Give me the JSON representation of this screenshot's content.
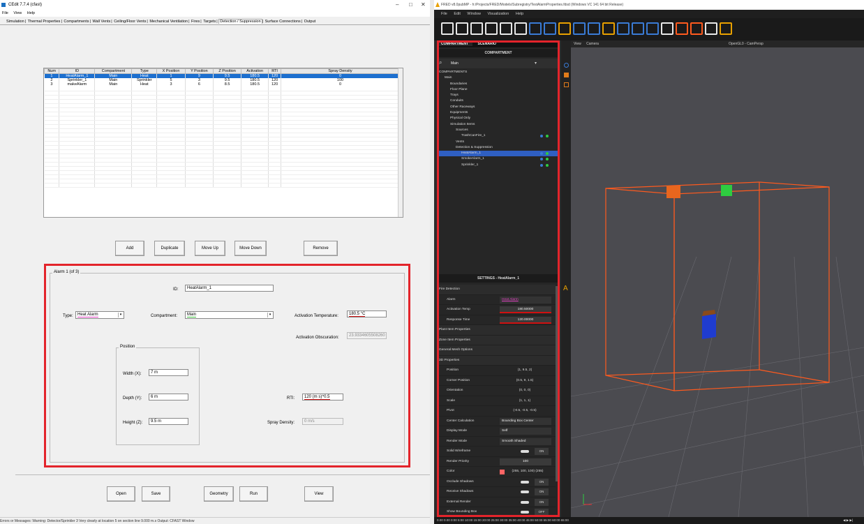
{
  "cfast": {
    "title": "CEdit 7.7.4 (cfast)",
    "menu": [
      "File",
      "View",
      "Help"
    ],
    "tabs": [
      "Simulation",
      "Thermal Properties",
      "Compartments",
      "Wall Vents",
      "Ceiling/Floor Vents",
      "Mechanical Ventilation",
      "Fires",
      "Targets",
      "Detection / Suppression",
      "Surface Connections",
      "Output"
    ],
    "active_tab": "Detection / Suppression",
    "grid": {
      "columns": [
        "Num",
        "ID",
        "Compartment",
        "Type",
        "X Position",
        "Y Position",
        "Z Position",
        "Activation",
        "RTI",
        "Spray Density"
      ],
      "rows": [
        [
          "1",
          "HeatAlarm_1",
          "Main",
          "Heat",
          "1",
          "9",
          "9.5",
          "180.5",
          "120",
          "0"
        ],
        [
          "2",
          "Sprinkler_1",
          "Main",
          "Sprinkler",
          "5",
          "3",
          "9.5",
          "180.5",
          "120",
          "100"
        ],
        [
          "3",
          "makeAlarm",
          "Main",
          "Heat",
          "3",
          "6",
          "8.5",
          "180.5",
          "120",
          "0"
        ]
      ]
    },
    "buttons": {
      "add": "Add",
      "duplicate": "Duplicate",
      "move_up": "Move Up",
      "move_down": "Move Down",
      "remove": "Remove",
      "open": "Open",
      "save": "Save",
      "geometry": "Geometry",
      "run": "Run",
      "view": "View"
    },
    "alarm": {
      "group_title": "Alarm 1 (of 3)",
      "id_label": "ID:",
      "id_value": "HeatAlarm_1",
      "type_label": "Type:",
      "type_value": "Heat Alarm",
      "compartment_label": "Compartment:",
      "compartment_value": "Main",
      "act_temp_label": "Activation Temperature:",
      "act_temp_value": "180.5 °C",
      "act_obsc_label": "Activation Obscuration:",
      "act_obsc_value": "23.9334605508260",
      "position_title": "Position",
      "width_label": "Width (X):",
      "width_value": "7 m",
      "depth_label": "Depth (Y):",
      "depth_value": "6 m",
      "height_label": "Height (Z):",
      "height_value": "9.5 m",
      "rti_label": "RTI:",
      "rti_value": "120 (m s)^0.5",
      "spray_label": "Spray Density:",
      "spray_value": "0 m/s"
    },
    "status": "Errors or Messages:      Warning: Detector/Sprinkler 3 Very clearly at location 5 on section line 9.000 m.s               Output: CFAST Window"
  },
  "fred": {
    "title": "FRED v8.0pubMP - h:/Projects/FRED/Models/Subregistry/TestAlarmProperties.fdsd (Windows VC 141 64 bit Release)",
    "menu": [
      "File",
      "Edit",
      "Window",
      "Visualization",
      "Help"
    ],
    "panel_tabs": [
      "COMPARTMENT",
      "SCENARIO"
    ],
    "panel_title": "COMPARTMENT",
    "search_value": "Main",
    "tree": [
      {
        "label": "COMPARTMENTS",
        "indent": 0
      },
      {
        "label": "Main",
        "indent": 1
      },
      {
        "label": "Boundaries",
        "indent": 2
      },
      {
        "label": "Floor Plane",
        "indent": 2
      },
      {
        "label": "Trays",
        "indent": 2
      },
      {
        "label": "Conduits",
        "indent": 2
      },
      {
        "label": "Other Raceways",
        "indent": 2
      },
      {
        "label": "Equipments",
        "indent": 2
      },
      {
        "label": "Physical Only",
        "indent": 2
      },
      {
        "label": "Simulation Items",
        "indent": 2
      },
      {
        "label": "Sources",
        "indent": 3
      },
      {
        "label": "TrashCanFire_1",
        "indent": 4
      },
      {
        "label": "Vents",
        "indent": 3
      },
      {
        "label": "Detection & Suppression",
        "indent": 3
      },
      {
        "label": "HeatAlarm_1",
        "indent": 4
      },
      {
        "label": "SmokeAlarm_1",
        "indent": 4
      },
      {
        "label": "Sprinkler_1",
        "indent": 4
      }
    ],
    "settings_title": "SETTINGS - HeatAlarm_1",
    "settings": {
      "fire_detection": "Fire Detection",
      "alarm_label": "Alarm",
      "alarm_value": "Heat Alarm",
      "act_temp_label": "Activation Temp",
      "act_temp_value": "180.50000",
      "resp_label": "Response Time",
      "resp_value": "120.00000",
      "plant": "Plant Item Properties",
      "zone": "Zone Item Properties",
      "mesh": "General Mesh Options",
      "props3d": "3D Properties",
      "position_label": "Position",
      "position_value": "(1, 9.5, 2)",
      "corner_label": "Corner Position",
      "corner_value": "(0.5, 9, 1.5)",
      "orient_label": "Orientation",
      "orient_value": "(0, 0, 0)",
      "scale_label": "Scale",
      "scale_value": "(1, 1, 1)",
      "pivot_label": "Pivot",
      "pivot_value": "(-0.5, -0.5, -0.5)",
      "center_label": "Center Calculation",
      "center_value": "Bounding Box Center",
      "display_label": "Display Mode",
      "display_value": "Self",
      "render_label": "Render Mode",
      "render_value": "Smooth Shaded",
      "wire_label": "Solid Wireframe",
      "wire_value": "ON",
      "prio_label": "Render Priority",
      "prio_value": "100",
      "color_label": "Color",
      "color_value": "(255, 100, 100) (255)",
      "occ_label": "Occlude Shadows",
      "occ_value": "ON",
      "recv_label": "Receive Shadows",
      "recv_value": "ON",
      "ext_label": "External Render",
      "ext_value": "ON",
      "bbox_label": "Show Bounding Box",
      "bbox_value": "OFF"
    },
    "viewport": {
      "menu1": "View",
      "menu2": "Camera",
      "label": "OpenGL0 - CamPersp"
    },
    "bottom": "0.00   0.00    0:00    5:00   10:00  15:00  20:00  25:00  30:00  35:00  40:00  45:00  50:00  55:00  60:00  65:00"
  }
}
